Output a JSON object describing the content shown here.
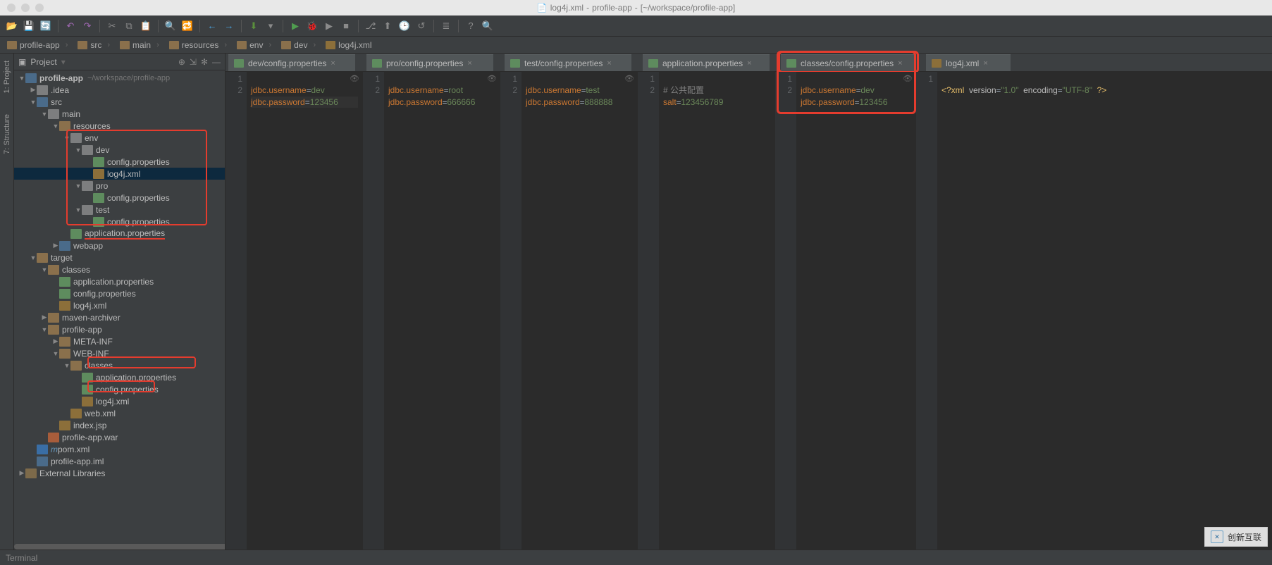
{
  "window": {
    "title_file": "log4j.xml",
    "title_project": "profile-app",
    "title_path": "[~/workspace/profile-app]"
  },
  "breadcrumbs": [
    "profile-app",
    "src",
    "main",
    "resources",
    "env",
    "dev",
    "log4j.xml"
  ],
  "sidebar_tools": {
    "project": "1: Project",
    "structure": "7: Structure"
  },
  "project_panel": {
    "title": "Project"
  },
  "tree": {
    "root": {
      "name": "profile-app",
      "path": "~/workspace/profile-app"
    },
    "idea": ".idea",
    "src": "src",
    "main": "main",
    "resources": "resources",
    "env": "env",
    "dev": "dev",
    "dev_config": "config.properties",
    "dev_log4j": "log4j.xml",
    "pro": "pro",
    "pro_config": "config.properties",
    "test": "test",
    "test_config": "config.properties",
    "app_props": "application.properties",
    "webapp": "webapp",
    "target": "target",
    "classes": "classes",
    "cls_app_props": "application.properties",
    "cls_config": "config.properties",
    "cls_log4j": "log4j.xml",
    "maven_archiver": "maven-archiver",
    "profile_app_dir": "profile-app",
    "meta_inf": "META-INF",
    "web_inf": "WEB-INF",
    "webinf_classes": "classes",
    "wcls_app_props": "application.properties",
    "wcls_config": "config.properties",
    "wcls_log4j": "log4j.xml",
    "web_xml": "web.xml",
    "index_jsp": "index.jsp",
    "war": "profile-app.war",
    "pom": "pom.xml",
    "iml": "profile-app.iml",
    "ext_libs": "External Libraries"
  },
  "tabs": [
    {
      "label": "dev/config.properties",
      "type": "p"
    },
    {
      "label": "pro/config.properties",
      "type": "p"
    },
    {
      "label": "test/config.properties",
      "type": "p"
    },
    {
      "label": "application.properties",
      "type": "p"
    },
    {
      "label": "classes/config.properties",
      "type": "p",
      "highlight": true
    },
    {
      "label": "log4j.xml",
      "type": "x"
    }
  ],
  "panes": [
    {
      "lines": [
        "1",
        "2"
      ],
      "code": [
        {
          "key": "jdbc.username",
          "val": "dev"
        },
        {
          "key": "jdbc.password",
          "val": "123456",
          "hl": true
        }
      ]
    },
    {
      "lines": [
        "1",
        "2"
      ],
      "code": [
        {
          "key": "jdbc.username",
          "val": "root"
        },
        {
          "key": "jdbc.password",
          "val": "666666"
        }
      ]
    },
    {
      "lines": [
        "1",
        "2"
      ],
      "code": [
        {
          "key": "jdbc.username",
          "val": "test"
        },
        {
          "key": "jdbc.password",
          "val": "888888"
        }
      ]
    },
    {
      "lines": [
        "1",
        "2"
      ],
      "code_raw": [
        {
          "text": "# 公共配置",
          "comment": true
        },
        {
          "key": "salt",
          "val": "123456789"
        }
      ]
    },
    {
      "lines": [
        "1",
        "2"
      ],
      "code": [
        {
          "key": "jdbc.username",
          "val": "dev"
        },
        {
          "key": "jdbc.password",
          "val": "123456"
        }
      ],
      "highlight": true
    },
    {
      "lines": [
        "1"
      ],
      "xml": "<?xml version=\"1.0\" encoding=\"UTF-8\" ?>"
    }
  ],
  "status": {
    "terminal": "Terminal"
  },
  "watermark": "创新互联"
}
